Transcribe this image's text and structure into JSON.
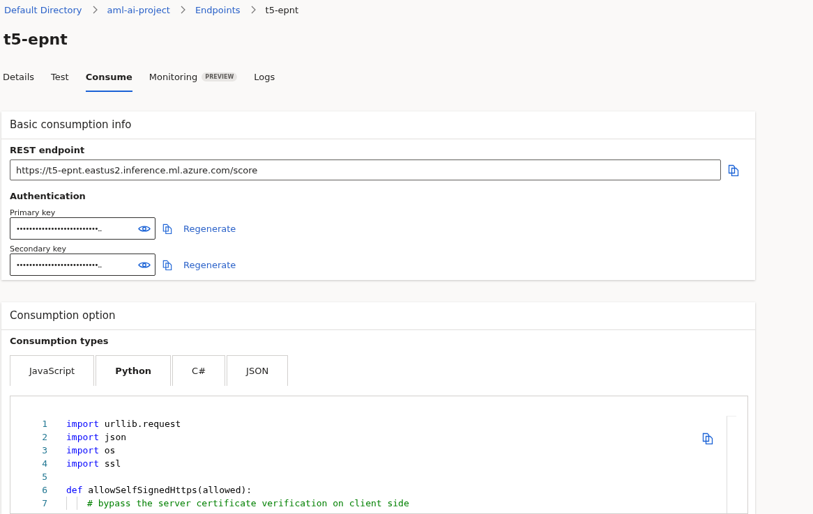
{
  "breadcrumb": [
    {
      "label": "Default Directory",
      "current": false
    },
    {
      "label": "aml-ai-project",
      "current": false
    },
    {
      "label": "Endpoints",
      "current": false
    },
    {
      "label": "t5-epnt",
      "current": true
    }
  ],
  "title": "t5-epnt",
  "tabs": [
    {
      "label": "Details",
      "selected": false
    },
    {
      "label": "Test",
      "selected": false
    },
    {
      "label": "Consume",
      "selected": true
    },
    {
      "label": "Monitoring",
      "selected": false,
      "badge": "PREVIEW"
    },
    {
      "label": "Logs",
      "selected": false
    }
  ],
  "basic_info": {
    "heading": "Basic consumption info",
    "rest_label": "REST endpoint",
    "rest_value": "https://t5-epnt.eastus2.inference.ml.azure.com/score",
    "auth_label": "Authentication",
    "keys": [
      {
        "label": "Primary key",
        "value": "••••••••••••••••••••••••••...",
        "action": "Regenerate"
      },
      {
        "label": "Secondary key",
        "value": "••••••••••••••••••••••••••...",
        "action": "Regenerate"
      }
    ]
  },
  "consumption": {
    "heading": "Consumption option",
    "types_label": "Consumption types",
    "type_tabs": [
      {
        "label": "JavaScript",
        "selected": false
      },
      {
        "label": "Python",
        "selected": true
      },
      {
        "label": "C#",
        "selected": false
      },
      {
        "label": "JSON",
        "selected": false
      }
    ],
    "code": [
      {
        "number": "1",
        "indent_guides": false,
        "tokens": [
          {
            "kind": "keyword",
            "text": "import"
          },
          {
            "kind": "plain",
            "text": " urllib.request"
          }
        ]
      },
      {
        "number": "2",
        "indent_guides": false,
        "tokens": [
          {
            "kind": "keyword",
            "text": "import"
          },
          {
            "kind": "plain",
            "text": " json"
          }
        ]
      },
      {
        "number": "3",
        "indent_guides": false,
        "tokens": [
          {
            "kind": "keyword",
            "text": "import"
          },
          {
            "kind": "plain",
            "text": " os"
          }
        ]
      },
      {
        "number": "4",
        "indent_guides": false,
        "tokens": [
          {
            "kind": "keyword",
            "text": "import"
          },
          {
            "kind": "plain",
            "text": " ssl"
          }
        ]
      },
      {
        "number": "5",
        "indent_guides": false
      },
      {
        "number": "6",
        "indent_guides": false,
        "tokens": [
          {
            "kind": "keyword",
            "text": "def"
          },
          {
            "kind": "plain",
            "text": " allowSelfSignedHttps(allowed):"
          }
        ]
      },
      {
        "number": "7",
        "indent_guides": true,
        "tokens": [
          {
            "kind": "comment",
            "text": "# bypass the server certificate verification on client side"
          }
        ]
      }
    ]
  }
}
